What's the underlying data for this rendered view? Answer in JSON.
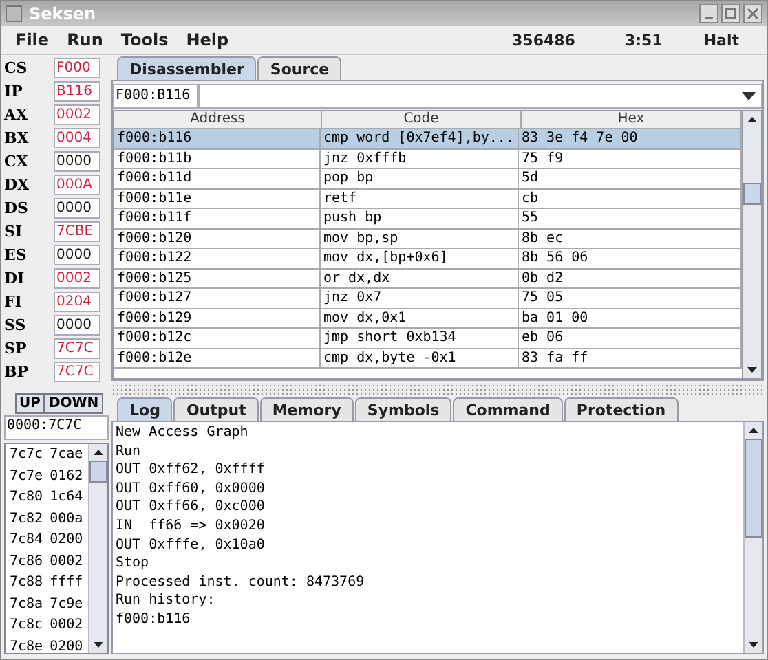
{
  "window": {
    "title": "Seksen"
  },
  "menu": [
    "File",
    "Run",
    "Tools",
    "Help"
  ],
  "status": {
    "count": "356486",
    "time": "3:51",
    "state": "Halt"
  },
  "registers": [
    {
      "name": "CS",
      "value": "F000",
      "changed": true
    },
    {
      "name": "IP",
      "value": "B116",
      "changed": true
    },
    {
      "name": "AX",
      "value": "0002",
      "changed": true
    },
    {
      "name": "BX",
      "value": "0004",
      "changed": true
    },
    {
      "name": "CX",
      "value": "0000",
      "changed": false
    },
    {
      "name": "DX",
      "value": "000A",
      "changed": true
    },
    {
      "name": "DS",
      "value": "0000",
      "changed": false
    },
    {
      "name": "SI",
      "value": "7CBE",
      "changed": true
    },
    {
      "name": "ES",
      "value": "0000",
      "changed": false
    },
    {
      "name": "DI",
      "value": "0002",
      "changed": true
    },
    {
      "name": "FI",
      "value": "0204",
      "changed": true
    },
    {
      "name": "SS",
      "value": "0000",
      "changed": false
    },
    {
      "name": "SP",
      "value": "7C7C",
      "changed": true
    },
    {
      "name": "BP",
      "value": "7C7C",
      "changed": true
    }
  ],
  "stack": {
    "buttons": [
      "UP",
      "DOWN"
    ],
    "address": "0000:7C7C",
    "rows": [
      {
        "address": "7c7c",
        "value": "7cae"
      },
      {
        "address": "7c7e",
        "value": "0162"
      },
      {
        "address": "7c80",
        "value": "1c64"
      },
      {
        "address": "7c82",
        "value": "000a"
      },
      {
        "address": "7c84",
        "value": "0200"
      },
      {
        "address": "7c86",
        "value": "0002"
      },
      {
        "address": "7c88",
        "value": "ffff"
      },
      {
        "address": "7c8a",
        "value": "7c9e"
      },
      {
        "address": "7c8c",
        "value": "0002"
      },
      {
        "address": "7c8e",
        "value": "0200"
      }
    ]
  },
  "top_tabs": [
    {
      "label": "Disassembler",
      "selected": true
    },
    {
      "label": "Source",
      "selected": false
    }
  ],
  "disassembler": {
    "address": "F000:B116",
    "columns": [
      "Address",
      "Code",
      "Hex"
    ],
    "rows": [
      {
        "address": "f000:b116",
        "code": "cmp word [0x7ef4],by...",
        "hex": "83 3e f4 7e 00",
        "selected": true
      },
      {
        "address": "f000:b11b",
        "code": "jnz 0xfffb",
        "hex": "75 f9",
        "selected": false
      },
      {
        "address": "f000:b11d",
        "code": "pop bp",
        "hex": "5d",
        "selected": false
      },
      {
        "address": "f000:b11e",
        "code": "retf",
        "hex": "cb",
        "selected": false
      },
      {
        "address": "f000:b11f",
        "code": "push bp",
        "hex": "55",
        "selected": false
      },
      {
        "address": "f000:b120",
        "code": "mov bp,sp",
        "hex": "8b ec",
        "selected": false
      },
      {
        "address": "f000:b122",
        "code": "mov dx,[bp+0x6]",
        "hex": "8b 56 06",
        "selected": false
      },
      {
        "address": "f000:b125",
        "code": "or dx,dx",
        "hex": "0b d2",
        "selected": false
      },
      {
        "address": "f000:b127",
        "code": "jnz 0x7",
        "hex": "75 05",
        "selected": false
      },
      {
        "address": "f000:b129",
        "code": "mov dx,0x1",
        "hex": "ba 01 00",
        "selected": false
      },
      {
        "address": "f000:b12c",
        "code": "jmp short 0xb134",
        "hex": "eb 06",
        "selected": false
      },
      {
        "address": "f000:b12e",
        "code": "cmp dx,byte -0x1",
        "hex": "83 fa ff",
        "selected": false
      }
    ]
  },
  "bottom_tabs": [
    {
      "label": "Log",
      "selected": true
    },
    {
      "label": "Output",
      "selected": false
    },
    {
      "label": "Memory",
      "selected": false
    },
    {
      "label": "Symbols",
      "selected": false
    },
    {
      "label": "Command",
      "selected": false
    },
    {
      "label": "Protection",
      "selected": false
    }
  ],
  "log": [
    "New Access Graph",
    "Run",
    "OUT 0xff62, 0xffff",
    "OUT 0xff60, 0x0000",
    "OUT 0xff66, 0xc000",
    "IN  ff66 => 0x0020",
    "OUT 0xfffe, 0x10a0",
    "Stop",
    "Processed inst. count: 8473769",
    "Run history:",
    "f000:b116"
  ]
}
